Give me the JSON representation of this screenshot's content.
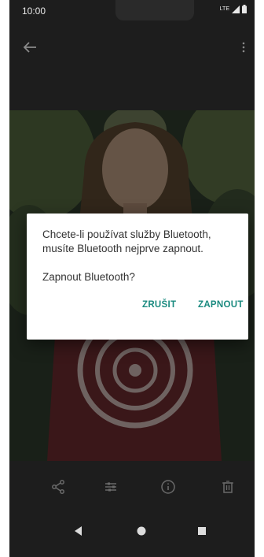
{
  "status_bar": {
    "time": "10:00",
    "network": "LTE"
  },
  "dialog": {
    "message": "Chcete-li používat služby Bluetooth, musíte Bluetooth nejprve zapnout.",
    "question": "Zapnout Bluetooth?",
    "cancel_label": "ZRUŠIT",
    "confirm_label": "ZAPNOUT"
  },
  "icons": {
    "back": "back-arrow-icon",
    "menu": "more-vert-icon",
    "share": "share-icon",
    "edit": "edit-icon",
    "info": "info-icon",
    "delete": "delete-icon",
    "nav_back": "nav-back-icon",
    "nav_home": "nav-home-icon",
    "nav_recents": "nav-recents-icon"
  },
  "colors": {
    "accent": "#1a8a7f",
    "screen_bg": "#1d1d1d"
  }
}
